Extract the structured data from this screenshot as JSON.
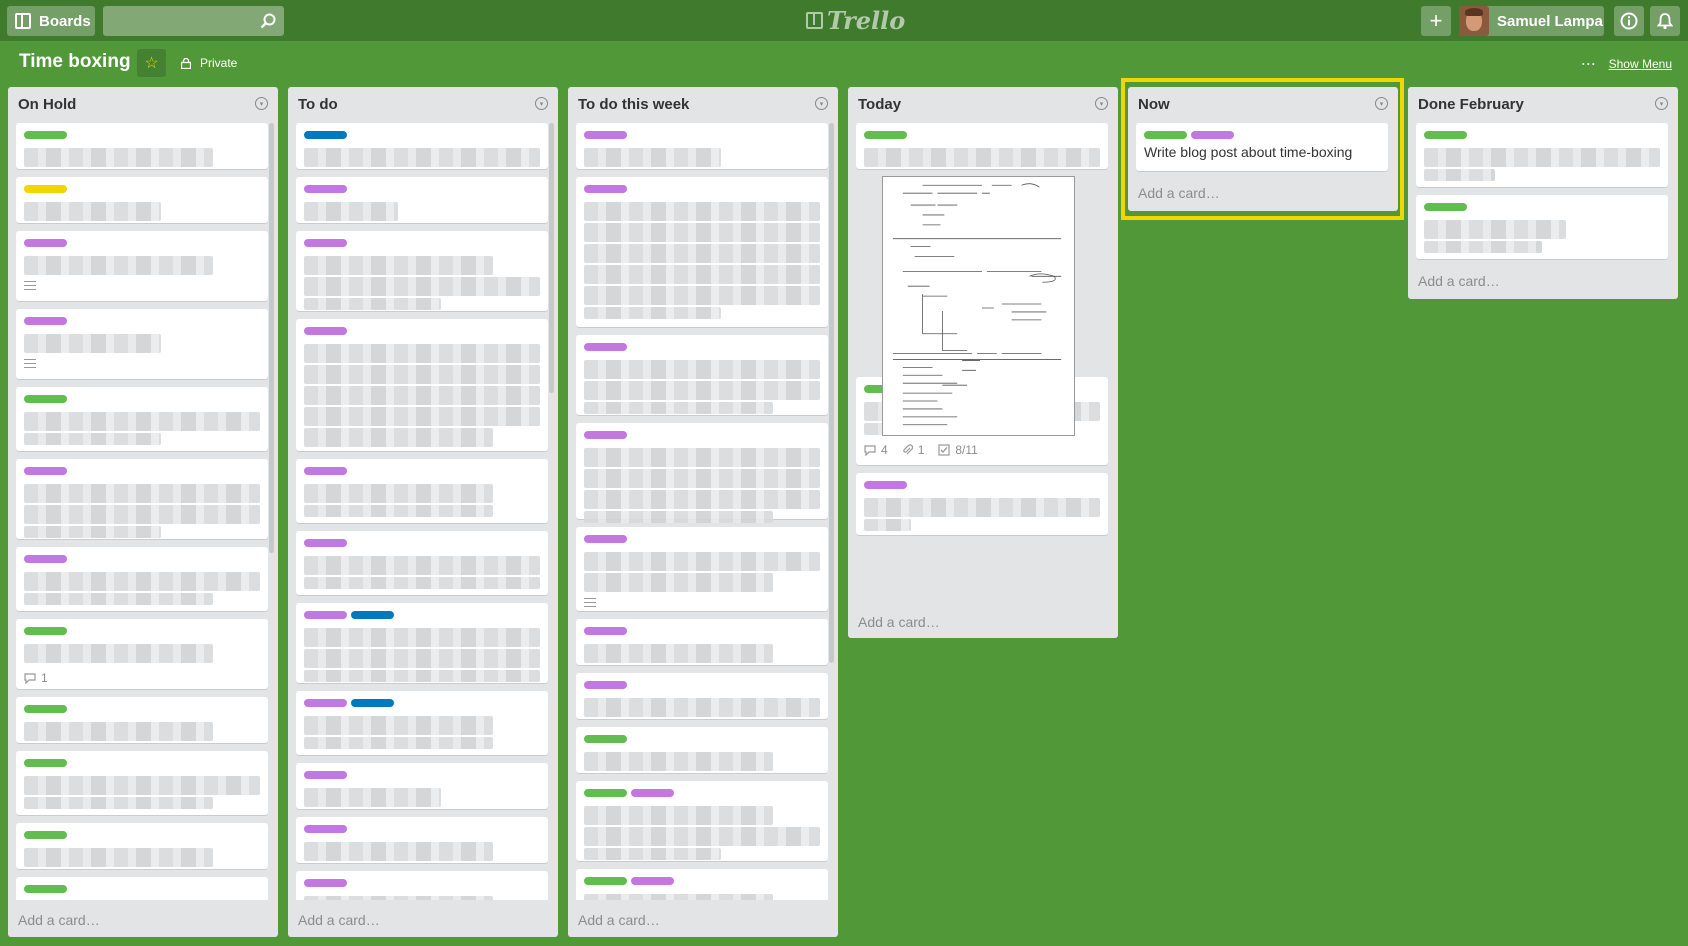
{
  "header": {
    "boards_label": "Boards",
    "logo_text": "Trello",
    "user_name": "Samuel Lampa"
  },
  "board": {
    "title": "Time boxing",
    "visibility": "Private",
    "show_menu": "Show Menu",
    "menu_dots": "···"
  },
  "lists": [
    {
      "title": "On Hold",
      "add_card": "Add a card…"
    },
    {
      "title": "To do",
      "add_card": "Add a card…"
    },
    {
      "title": "To do this week",
      "add_card": "Add a card…"
    },
    {
      "title": "Today",
      "add_card": "Add a card…",
      "badge_comments": "4",
      "badge_attachments": "1",
      "badge_checklist": "8/11"
    },
    {
      "title": "Now",
      "add_card": "Add a card…",
      "card_text": "Write blog post about time-boxing"
    },
    {
      "title": "Done February",
      "add_card": "Add a card…"
    }
  ],
  "on_hold_comment_badge": "1",
  "colors": {
    "board_bg": "#519839",
    "header_bg": "#3f7a2d",
    "label_green": "#61bd4f",
    "label_purple": "#c377e0",
    "label_blue": "#0079bf",
    "label_yellow": "#f2d600",
    "highlight": "#f2d600"
  }
}
